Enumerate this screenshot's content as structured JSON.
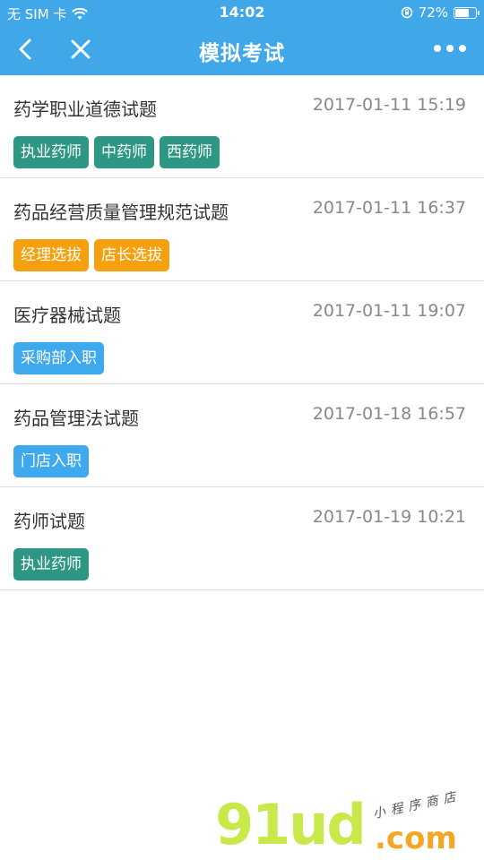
{
  "status_bar": {
    "carrier": "无 SIM 卡",
    "time": "14:02",
    "battery_percent": "72%",
    "battery_level": 0.72
  },
  "nav": {
    "title": "模拟考试"
  },
  "exams": [
    {
      "name": "药学职业道德试题",
      "date": "2017-01-11 15:19",
      "tags": [
        {
          "label": "执业药师",
          "color": "#2e9784"
        },
        {
          "label": "中药师",
          "color": "#2e9784"
        },
        {
          "label": "西药师",
          "color": "#2e9784"
        }
      ]
    },
    {
      "name": "药品经营质量管理规范试题",
      "date": "2017-01-11 16:37",
      "tags": [
        {
          "label": "经理选拔",
          "color": "#f5a10f"
        },
        {
          "label": "店长选拔",
          "color": "#f5a10f"
        }
      ]
    },
    {
      "name": "医疗器械试题",
      "date": "2017-01-11 19:07",
      "tags": [
        {
          "label": "采购部入职",
          "color": "#3fa9ee"
        }
      ]
    },
    {
      "name": "药品管理法试题",
      "date": "2017-01-18 16:57",
      "tags": [
        {
          "label": "门店入职",
          "color": "#3fa9ee"
        }
      ]
    },
    {
      "name": "药师试题",
      "date": "2017-01-19 10:21",
      "tags": [
        {
          "label": "执业药师",
          "color": "#2e9784"
        }
      ]
    }
  ],
  "watermark": {
    "brand": "91ud",
    "domain": ".com",
    "tagline": "小程序商店"
  },
  "colors": {
    "header": "#40a7e9",
    "green_tag": "#2e9784",
    "orange_tag": "#f5a10f",
    "blue_tag": "#3fa9ee"
  }
}
